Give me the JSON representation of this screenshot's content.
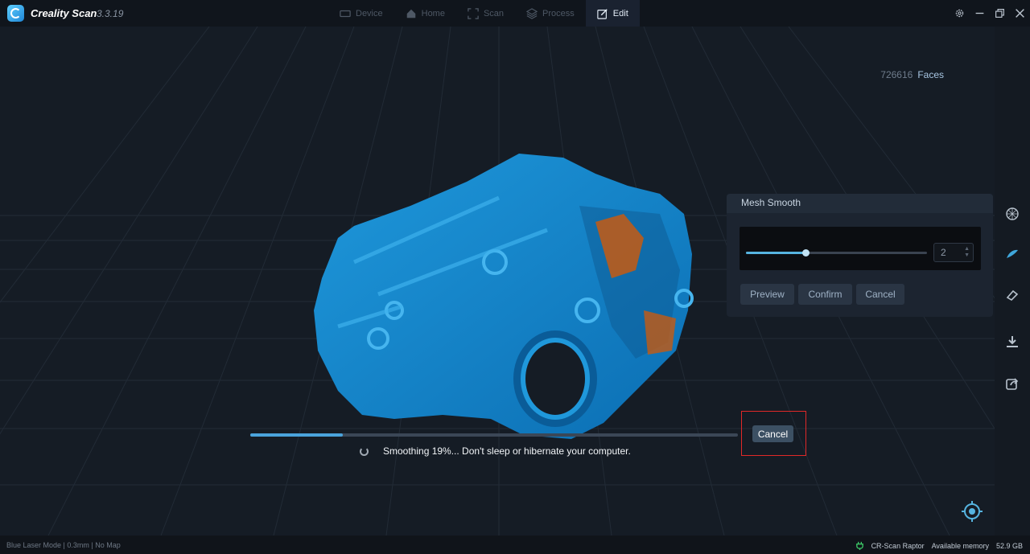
{
  "app": {
    "name": "Creality Scan",
    "version": "3.3.19"
  },
  "tabs": [
    {
      "label": "Device",
      "icon": "device-icon"
    },
    {
      "label": "Home",
      "icon": "home-icon"
    },
    {
      "label": "Scan",
      "icon": "scan-icon"
    },
    {
      "label": "Process",
      "icon": "layers-icon"
    },
    {
      "label": "Edit",
      "icon": "edit-icon",
      "active": true
    }
  ],
  "faces": {
    "count": "726616",
    "label": "Faces"
  },
  "mesh_smooth": {
    "title": "Mesh Smooth",
    "level": 2,
    "slider_fraction": 0.33,
    "buttons": {
      "preview": "Preview",
      "confirm": "Confirm",
      "cancel": "Cancel"
    }
  },
  "progress": {
    "percent": 19,
    "text": "Smoothing 19%... Don't sleep or hibernate your computer.",
    "cancel_label": "Cancel"
  },
  "status": {
    "mode": "Blue Laser Mode | 0.3mm | No Map",
    "device": "CR-Scan Raptor",
    "memory_label": "Available memory",
    "memory_value": "52.9 GB"
  },
  "colors": {
    "accent": "#4aa3dc",
    "model": "#1e8fd0",
    "highlight": "#e02828"
  }
}
